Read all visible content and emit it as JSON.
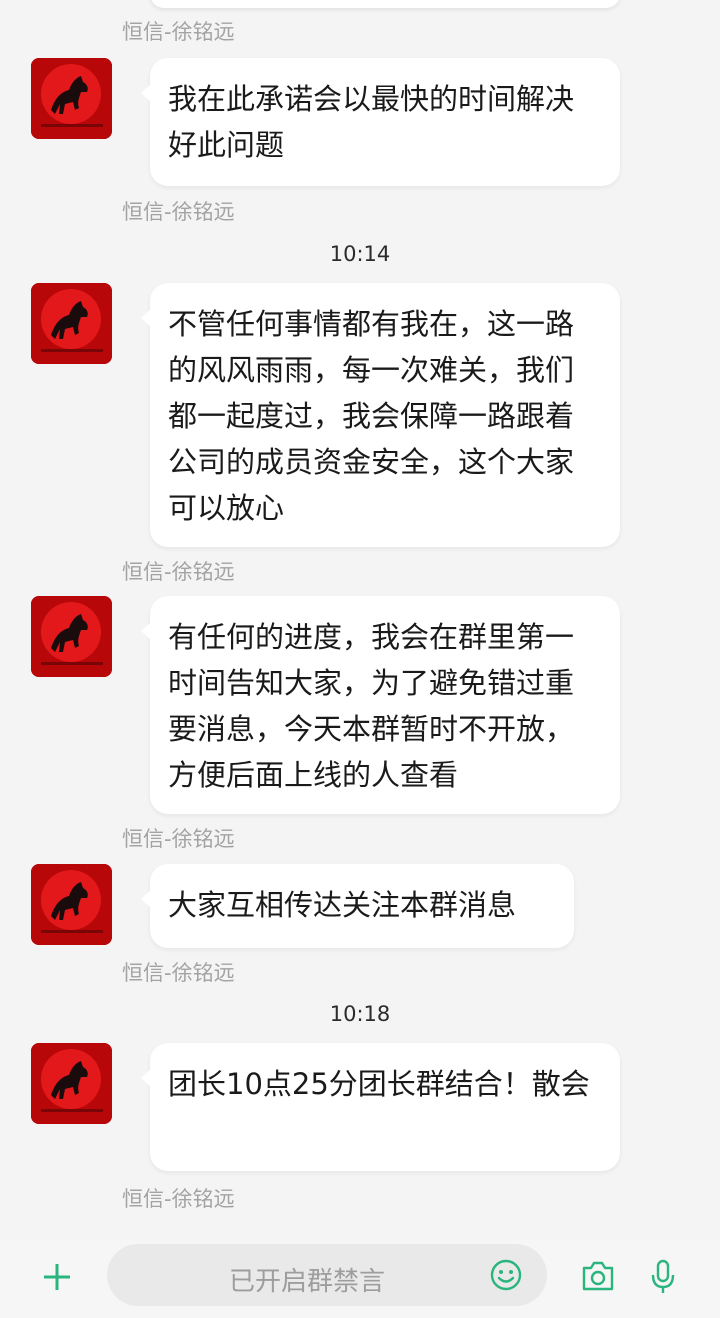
{
  "messages": [
    {
      "sender": "恒信-徐铭远",
      "text": "我在此承诺会以最快的时间解决好此问题"
    },
    {
      "sender": "恒信-徐铭远",
      "text": "不管任何事情都有我在，这一路的风风雨雨，每一次难关，我们都一起度过，我会保障一路跟着公司的成员资金安全，这个大家可以放心"
    },
    {
      "sender": "恒信-徐铭远",
      "text": "有任何的进度，我会在群里第一时间告知大家，为了避免错过重要消息，今天本群暂时不开放，方便后面上线的人查看"
    },
    {
      "sender": "恒信-徐铭远",
      "text": "大家互相传达关注本群消息"
    },
    {
      "sender": "恒信-徐铭远",
      "text": "团长10点25分团长群结合！散会"
    }
  ],
  "top_sender": "恒信-徐铭远",
  "timestamps": [
    "10:14",
    "10:18"
  ],
  "input": {
    "placeholder": "已开启群禁言"
  },
  "icons": {
    "avatar": "red-horse-avatar",
    "add": "plus-icon",
    "emoji": "smiley-icon",
    "camera": "camera-icon",
    "voice": "microphone-icon"
  },
  "colors": {
    "accent_green": "#2bb57e",
    "avatar_red": "#c8060a"
  }
}
